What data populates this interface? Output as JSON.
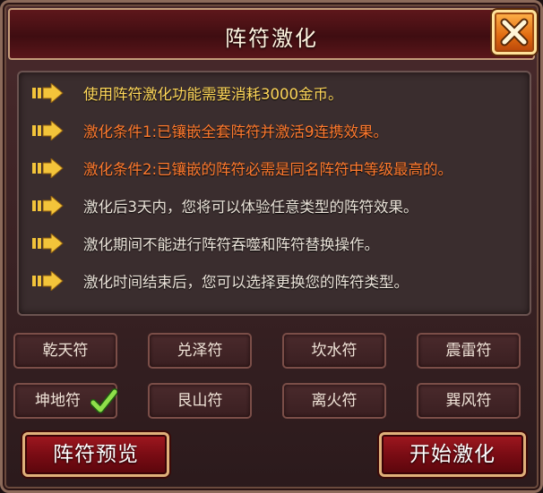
{
  "dialog": {
    "title": "阵符激化",
    "close_icon": "close-x-icon"
  },
  "info": {
    "lines": [
      {
        "text": "使用阵符激化功能需要消耗3000金币。",
        "color": "#ffd75a"
      },
      {
        "text": "激化条件1:已镶嵌全套阵符并激活9连携效果。",
        "color": "#ff7a2e"
      },
      {
        "text": "激化条件2:已镶嵌的阵符必需是同名阵符中等级最高的。",
        "color": "#ff7a2e"
      },
      {
        "text": "激化后3天内，您将可以体验任意类型的阵符效果。",
        "color": "#ece4da"
      },
      {
        "text": "激化期间不能进行阵符吞噬和阵符替换操作。",
        "color": "#ece4da"
      },
      {
        "text": "激化时间结束后，您可以选择更换您的阵符类型。",
        "color": "#ece4da"
      }
    ]
  },
  "runes": {
    "qian": "乾天符",
    "dui": "兑泽符",
    "kan": "坎水符",
    "zhen": "震雷符",
    "kun": "坤地符",
    "gen": "艮山符",
    "li": "离火符",
    "xun": "巽风符",
    "selected": "坤地符"
  },
  "actions": {
    "preview_label": "阵符预览",
    "start_label": "开始激化"
  }
}
